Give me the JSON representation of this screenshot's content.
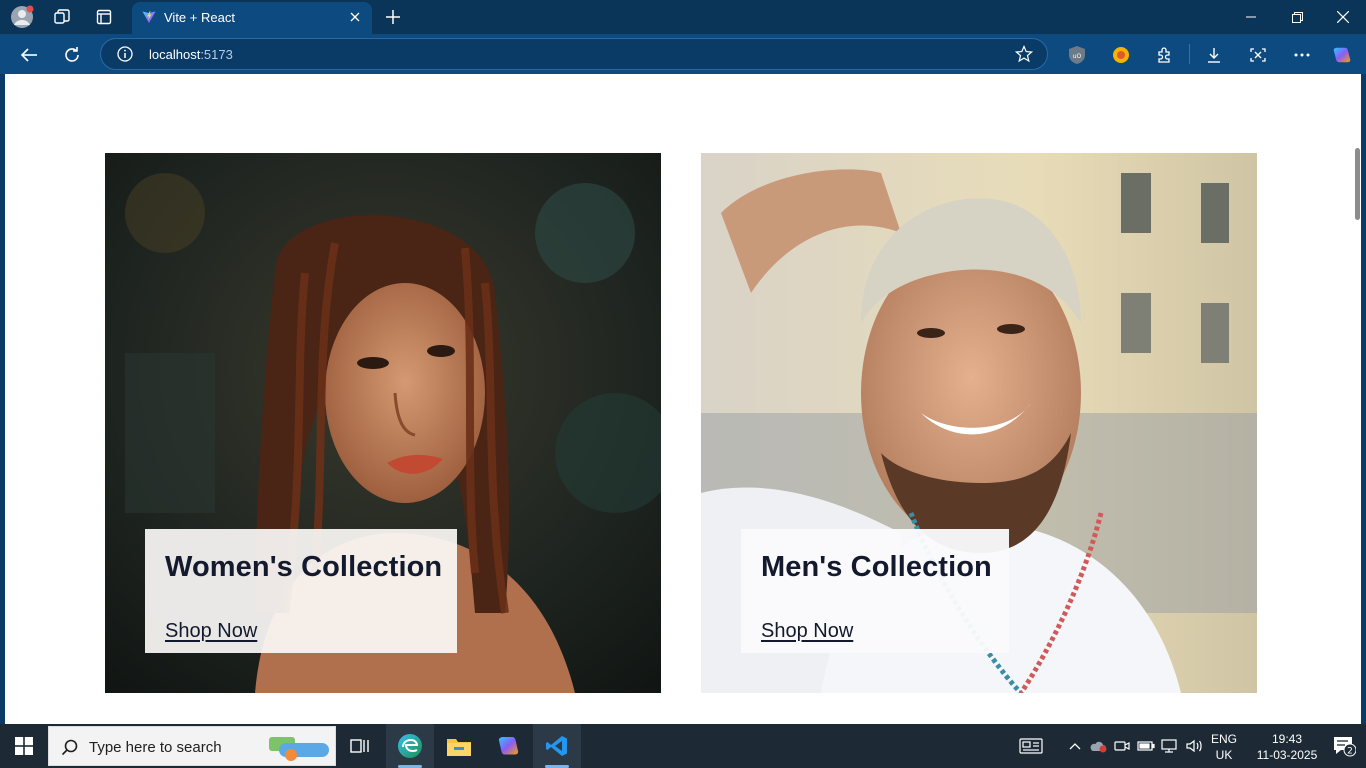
{
  "browser": {
    "tab_title": "Vite + React",
    "url_host": "localhost",
    "url_port": ":5173",
    "accent": "#0d4a80"
  },
  "page": {
    "cards": [
      {
        "title": "Women's Collection",
        "link": "Shop Now"
      },
      {
        "title": "Men's Collection",
        "link": "Shop Now"
      }
    ]
  },
  "taskbar": {
    "search_placeholder": "Type here to search",
    "lang_line1": "ENG",
    "lang_line2": "UK",
    "time": "19:43",
    "date": "11-03-2025",
    "notification_count": "2"
  }
}
